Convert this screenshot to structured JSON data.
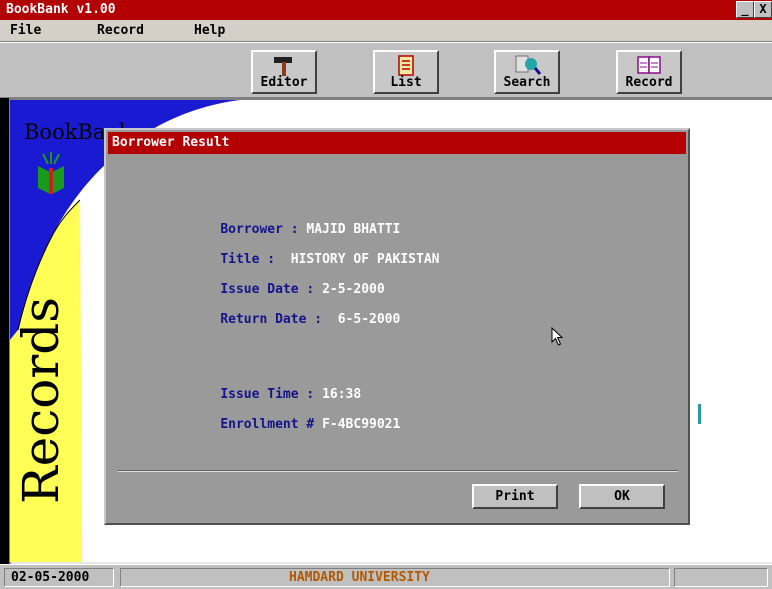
{
  "window": {
    "title": "BookBank v1.00",
    "minimize_label": "_",
    "close_label": "X"
  },
  "menu": {
    "items": [
      "File",
      "Record",
      "Help"
    ]
  },
  "toolbar": {
    "buttons": [
      {
        "label": "Editor",
        "icon": "hammer-icon"
      },
      {
        "label": "List",
        "icon": "list-icon"
      },
      {
        "label": "Search",
        "icon": "search-icon"
      },
      {
        "label": "Record",
        "icon": "book-icon"
      }
    ]
  },
  "sidebar": {
    "brand": "BookBank",
    "vertical_text": "Records"
  },
  "dialog": {
    "title": "Borrower Result",
    "fields": {
      "borrower": {
        "label": "Borrower : ",
        "value": "MAJID BHATTI"
      },
      "title": {
        "label": "Title :  ",
        "value": "HISTORY OF PAKISTAN"
      },
      "issue_date": {
        "label": "Issue Date : ",
        "value": "2-5-2000"
      },
      "return_date": {
        "label": "Return Date :  ",
        "value": "6-5-2000"
      },
      "issue_time": {
        "label": "Issue Time : ",
        "value": "16:38"
      },
      "enrollment": {
        "label": "Enrollment # ",
        "value": "F-4BC99021"
      }
    },
    "print_label": "Print",
    "ok_label": "OK"
  },
  "status": {
    "date": "02-05-2000",
    "organization": "HAMDARD UNIVERSITY"
  },
  "colors": {
    "accent": "#b30000",
    "field_label": "#14148c",
    "sidebar_blue": "#1a1ad2",
    "sidebar_yellow": "#ffff55",
    "status_text": "#b35a00"
  }
}
